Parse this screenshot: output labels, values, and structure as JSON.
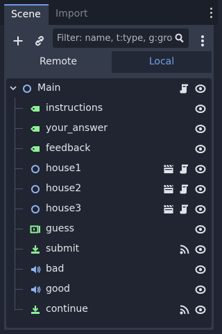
{
  "tabs": [
    {
      "label": "Scene",
      "active": true
    },
    {
      "label": "Import",
      "active": false
    }
  ],
  "filter": {
    "placeholder": "Filter: name, t:type, g:gro"
  },
  "segments": {
    "remote": "Remote",
    "local": "Local",
    "selected": "Local"
  },
  "colors": {
    "accent": "#6fa1ec",
    "node_2d": "#8fb4ee",
    "control": "#8eef97",
    "panel": "#343b4b",
    "tree_bg": "#202531"
  },
  "tree": {
    "root": {
      "name": "Main",
      "icon": "node-circle-icon",
      "badges": [
        "script-icon",
        "visibility-icon"
      ]
    },
    "children": [
      {
        "name": "instructions",
        "icon": "label-icon",
        "badges": [
          "visibility-icon"
        ]
      },
      {
        "name": "your_answer",
        "icon": "label-icon",
        "badges": [
          "visibility-icon"
        ]
      },
      {
        "name": "feedback",
        "icon": "label-icon",
        "badges": [
          "visibility-icon"
        ]
      },
      {
        "name": "house1",
        "icon": "node-circle-icon",
        "badges": [
          "clapper-icon",
          "script-icon",
          "visibility-icon"
        ]
      },
      {
        "name": "house2",
        "icon": "node-circle-icon",
        "badges": [
          "clapper-icon",
          "script-icon",
          "visibility-icon"
        ]
      },
      {
        "name": "house3",
        "icon": "node-circle-icon",
        "badges": [
          "clapper-icon",
          "script-icon",
          "visibility-icon"
        ]
      },
      {
        "name": "guess",
        "icon": "line-edit-icon",
        "badges": [
          "visibility-icon"
        ]
      },
      {
        "name": "submit",
        "icon": "button-icon",
        "badges": [
          "signal-icon",
          "visibility-icon"
        ]
      },
      {
        "name": "bad",
        "icon": "audio-icon",
        "badges": [
          "visibility-icon"
        ]
      },
      {
        "name": "good",
        "icon": "audio-icon",
        "badges": [
          "visibility-icon"
        ]
      },
      {
        "name": "continue",
        "icon": "button-icon",
        "badges": [
          "signal-icon",
          "visibility-icon"
        ]
      }
    ]
  }
}
